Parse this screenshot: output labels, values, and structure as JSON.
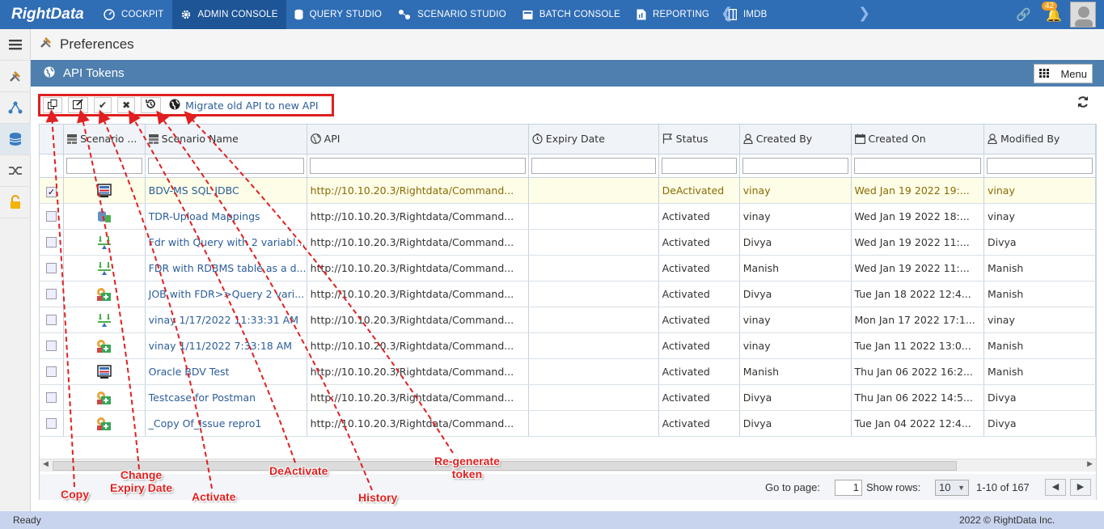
{
  "app": {
    "logo": "RightData"
  },
  "nav": [
    {
      "label": "COCKPIT",
      "icon": "cockpit-icon"
    },
    {
      "label": "ADMIN CONSOLE",
      "icon": "gear-icon",
      "active": true
    },
    {
      "label": "QUERY STUDIO",
      "icon": "database-icon"
    },
    {
      "label": "SCENARIO STUDIO",
      "icon": "scenario-icon"
    },
    {
      "label": "BATCH CONSOLE",
      "icon": "batch-icon"
    },
    {
      "label": "REPORTING",
      "icon": "report-icon"
    },
    {
      "label": "IMDB",
      "icon": "imdb-icon"
    }
  ],
  "notifications": {
    "count": "42"
  },
  "preferences": {
    "title": "Preferences"
  },
  "panel": {
    "title": "API Tokens",
    "menu_label": "Menu"
  },
  "toolbar": {
    "migrate_label": "Migrate old API to new API"
  },
  "columns": [
    "Scenario ...",
    "Scenario Name",
    "API",
    "Expiry Date",
    "Status",
    "Created By",
    "Created On",
    "Modified By"
  ],
  "rows": [
    {
      "selected": true,
      "icon": "bdv-icon",
      "name": "BDV-MS SQL JDBC",
      "api": "http://10.10.20.3/Rightdata/Command...",
      "expiry": "",
      "status": "DeActivated",
      "created_by": "vinay",
      "created_on": "Wed Jan 19 2022 19:...",
      "modified_by": "vinay"
    },
    {
      "selected": false,
      "icon": "upload-icon",
      "name": "TDR-Upload Mappings",
      "api": "http://10.10.20.3/Rightdata/Command...",
      "expiry": "",
      "status": "Activated",
      "created_by": "vinay",
      "created_on": "Wed Jan 19 2022 18:...",
      "modified_by": "vinay"
    },
    {
      "selected": false,
      "icon": "fdr-icon",
      "name": "Fdr with Query with 2 variabl...",
      "api": "http://10.10.20.3/Rightdata/Command...",
      "expiry": "",
      "status": "Activated",
      "created_by": "Divya",
      "created_on": "Wed Jan 19 2022 11:...",
      "modified_by": "Divya"
    },
    {
      "selected": false,
      "icon": "fdr-icon",
      "name": "FDR with RDBMS table as a d...",
      "api": "http://10.10.20.3/Rightdata/Command...",
      "expiry": "",
      "status": "Activated",
      "created_by": "Manish",
      "created_on": "Wed Jan 19 2022 11:...",
      "modified_by": "Manish"
    },
    {
      "selected": false,
      "icon": "job-icon",
      "name": "JOB with FDR>>Query 2 vari...",
      "api": "http://10.10.20.3/Rightdata/Command...",
      "expiry": "",
      "status": "Activated",
      "created_by": "Divya",
      "created_on": "Tue Jan 18 2022 12:4...",
      "modified_by": "Manish"
    },
    {
      "selected": false,
      "icon": "fdr-icon",
      "name": "vinay 1/17/2022 11:33:31 AM",
      "api": "http://10.10.20.3/Rightdata/Command...",
      "expiry": "",
      "status": "Activated",
      "created_by": "vinay",
      "created_on": "Mon Jan 17 2022 17:1...",
      "modified_by": "vinay"
    },
    {
      "selected": false,
      "icon": "job-icon",
      "name": "vinay 1/11/2022 7:33:18 AM",
      "api": "http://10.10.20.3/Rightdata/Command...",
      "expiry": "",
      "status": "Activated",
      "created_by": "vinay",
      "created_on": "Tue Jan 11 2022 13:0...",
      "modified_by": "Manish"
    },
    {
      "selected": false,
      "icon": "bdv-icon",
      "name": "Oracle BDV Test",
      "api": "http://10.10.20.3/Rightdata/Command...",
      "expiry": "",
      "status": "Activated",
      "created_by": "Manish",
      "created_on": "Thu Jan 06 2022 16:2...",
      "modified_by": "Manish"
    },
    {
      "selected": false,
      "icon": "job-icon",
      "name": "Testcase for Postman",
      "api": "http://10.10.20.3/Rightdata/Command...",
      "expiry": "",
      "status": "Activated",
      "created_by": "Divya",
      "created_on": "Thu Jan 06 2022 14:5...",
      "modified_by": "Divya"
    },
    {
      "selected": false,
      "icon": "job-icon",
      "name": "_Copy Of_Issue repro1",
      "api": "http://10.10.20.3/Rightdata/Command...",
      "expiry": "",
      "status": "Activated",
      "created_by": "Divya",
      "created_on": "Tue Jan 04 2022 12:4...",
      "modified_by": "Divya"
    }
  ],
  "pager": {
    "goto_label": "Go to page:",
    "page": "1",
    "rows_label": "Show rows:",
    "rows_value": "10",
    "range": "1-10 of 167"
  },
  "status": {
    "left": "Ready",
    "right": "2022 © RightData Inc."
  },
  "annotations": {
    "copy": "Copy",
    "change_expiry_1": "Change",
    "change_expiry_2": "Expiry Date",
    "activate": "Activate",
    "deactivate": "DeActivate",
    "history": "History",
    "regenerate_1": "Re-generate",
    "regenerate_2": "token"
  },
  "colors": {
    "topbar": "#2f6db5",
    "panel_header": "#4f7fae",
    "annotation": "#e02020",
    "link": "#2a5d9a"
  }
}
